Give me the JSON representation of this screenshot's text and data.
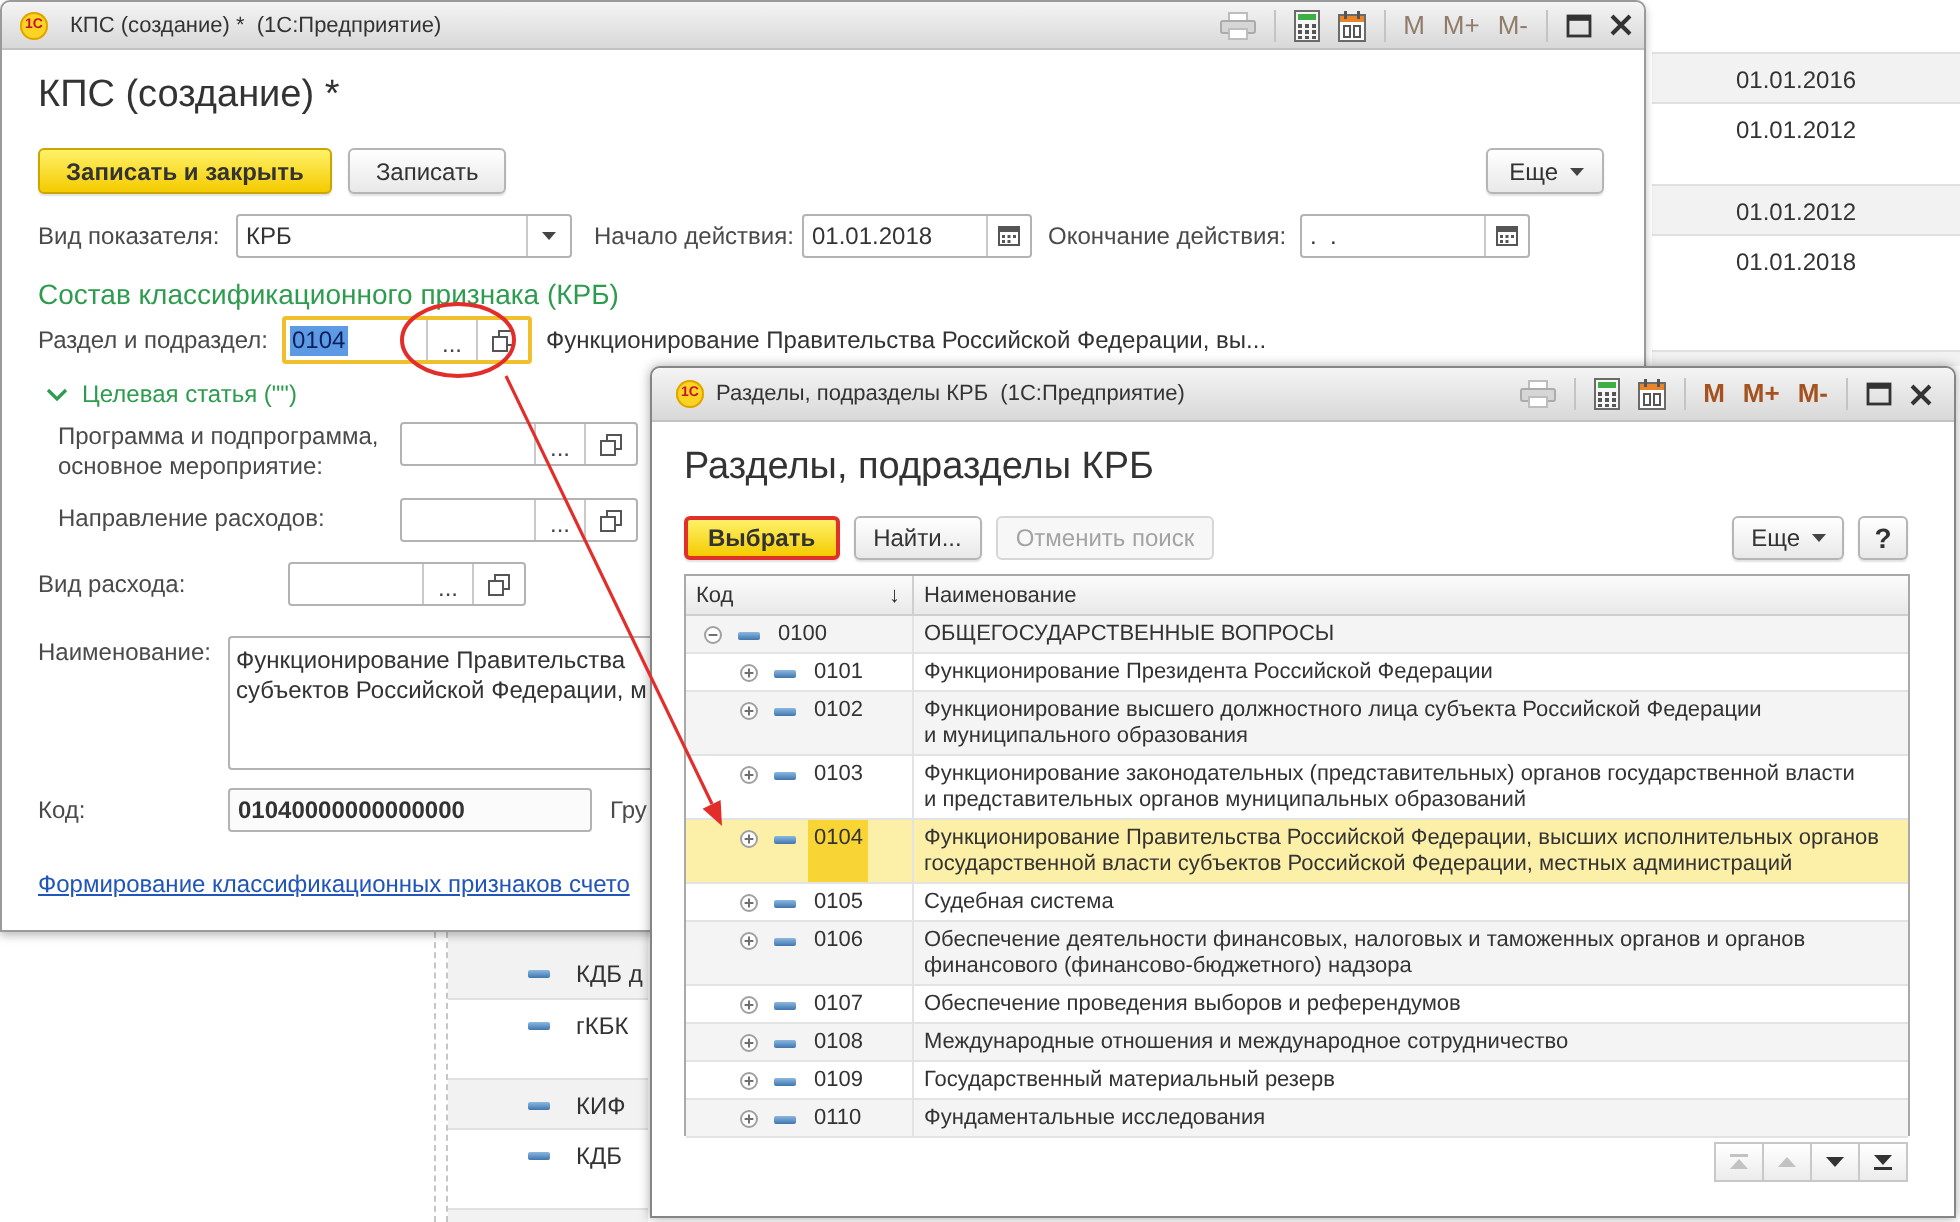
{
  "background_list": {
    "top_rows": [
      {
        "date": "01.01.2016"
      },
      {
        "date": "01.01.2012"
      },
      {
        "date": "01.01.2012"
      },
      {
        "date": "01.01.2018"
      }
    ],
    "bottom_rows": [
      {
        "name": "КДБ д"
      },
      {
        "name": "гКБК"
      },
      {
        "name": "КИФ"
      },
      {
        "name": "КДБ"
      }
    ]
  },
  "form_window": {
    "logo": "1С",
    "title": "КПС (создание) *  (1С:Предприятие)",
    "active": false,
    "memory_buttons": [
      "M",
      "M+",
      "M-"
    ],
    "heading": "КПС (создание) *",
    "buttons": [
      {
        "label": "Записать и закрыть",
        "kind": "default"
      },
      {
        "label": "Записать",
        "kind": "normal"
      }
    ],
    "more_button": "Еще",
    "indicator_type": {
      "label": "Вид показателя:",
      "value": "КРБ"
    },
    "start_date": {
      "label": "Начало действия:",
      "value": "01.01.2018"
    },
    "end_date": {
      "label": "Окончание действия:",
      "value": ".  ."
    },
    "section_title": "Состав классификационного признака (КРБ)",
    "section": {
      "label": "Раздел и подраздел:",
      "value": "0104",
      "focused": true,
      "text_selected": true,
      "choose_button": "...",
      "description": "Функционирование Правительства Российской Федерации, вы..."
    },
    "target_article": {
      "title": "Целевая статья (\"\")",
      "expanded": true,
      "fields": [
        {
          "label": "Программа и подпрограмма, основное мероприятие:",
          "choose_button": "..."
        },
        {
          "label": "Направление расходов:",
          "choose_button": "..."
        }
      ]
    },
    "expense_type": {
      "label": "Вид расхода:",
      "choose_button": "..."
    },
    "name": {
      "label": "Наименование:",
      "value": "Функционирование Правительства\nсубъектов Российской Федерации, м"
    },
    "code": {
      "label": "Код:",
      "value": "01040000000000000"
    },
    "group_label": "Гру",
    "link": "Формирование классификационных признаков счето"
  },
  "selection_dialog": {
    "logo": "1С",
    "title": "Разделы, подразделы КРБ  (1С:Предприятие)",
    "active": true,
    "memory_buttons": [
      "M",
      "M+",
      "M-"
    ],
    "heading": "Разделы, подразделы КРБ",
    "buttons": [
      {
        "label": "Выбрать",
        "kind": "default",
        "disabled": false,
        "highlighted": true
      },
      {
        "label": "Найти...",
        "kind": "normal",
        "disabled": false,
        "highlighted": false
      },
      {
        "label": "Отменить поиск",
        "kind": "normal",
        "disabled": true,
        "highlighted": false
      }
    ],
    "more_button": "Еще",
    "help_button": "?",
    "table": {
      "columns": [
        {
          "title": "Код",
          "sort_mark": "↓"
        },
        {
          "title": "Наименование"
        }
      ],
      "rows": [
        {
          "code": "0100",
          "name": "ОБЩЕГОСУДАРСТВЕННЫЕ ВОПРОСЫ",
          "expanded": true,
          "selected": false,
          "children": [
            {
              "code": "0101",
              "name": "Функционирование Президента Российской Федерации",
              "expanded": false,
              "selected": false
            },
            {
              "code": "0102",
              "name": "Функционирование высшего должностного лица субъекта Российской Федерации\nи муниципального образования",
              "expanded": false,
              "selected": false
            },
            {
              "code": "0103",
              "name": "Функционирование законодательных (представительных) органов государственной власти\nи представительных органов муниципальных образований",
              "expanded": false,
              "selected": false
            },
            {
              "code": "0104",
              "name": "Функционирование Правительства Российской Федерации, высших исполнительных органов\nгосударственной власти субъектов Российской Федерации, местных администраций",
              "expanded": false,
              "selected": true
            },
            {
              "code": "0105",
              "name": "Судебная система",
              "expanded": false,
              "selected": false
            },
            {
              "code": "0106",
              "name": "Обеспечение деятельности финансовых, налоговых и таможенных органов и органов\nфинансового (финансово-бюджетного) надзора",
              "expanded": false,
              "selected": false
            },
            {
              "code": "0107",
              "name": "Обеспечение проведения выборов и референдумов",
              "expanded": false,
              "selected": false
            },
            {
              "code": "0108",
              "name": "Международные отношения и международное сотрудничество",
              "expanded": false,
              "selected": false
            },
            {
              "code": "0109",
              "name": "Государственный материальный резерв",
              "expanded": false,
              "selected": false
            },
            {
              "code": "0110",
              "name": "Фундаментальные исследования",
              "expanded": false,
              "selected": false
            }
          ]
        }
      ]
    },
    "navigation": [
      {
        "kind": "first",
        "disabled": true
      },
      {
        "kind": "up",
        "disabled": true
      },
      {
        "kind": "down",
        "disabled": false
      },
      {
        "kind": "last",
        "disabled": false
      }
    ]
  }
}
